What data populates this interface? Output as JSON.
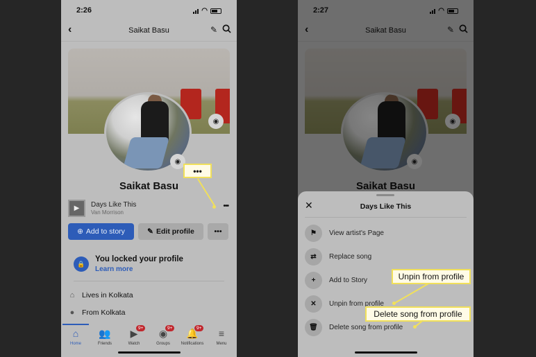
{
  "left_screen": {
    "status": {
      "time": "2:26"
    },
    "navbar": {
      "back": "‹",
      "title": "Saikat Basu",
      "edit_icon": "✎"
    },
    "profile_name": "Saikat Basu",
    "song": {
      "title": "Days Like This",
      "artist": "Van Morrison",
      "more": "•••"
    },
    "actions": {
      "add_story": "Add to story",
      "edit_profile": "Edit profile",
      "more": "•••"
    },
    "locked": {
      "heading": "You locked your profile",
      "link": "Learn more"
    },
    "info": [
      {
        "icon": "home-icon",
        "glyph": "⌂",
        "text": "Lives in Kolkata"
      },
      {
        "icon": "location-pin-icon",
        "glyph": "●",
        "text": "From Kolkata"
      }
    ],
    "tabs": [
      {
        "label": "Home",
        "glyph": "⌂",
        "badge": "",
        "active": true
      },
      {
        "label": "Friends",
        "glyph": "👥",
        "badge": ""
      },
      {
        "label": "Watch",
        "glyph": "▶",
        "badge": "9+"
      },
      {
        "label": "Groups",
        "glyph": "◉",
        "badge": "9+"
      },
      {
        "label": "Notifications",
        "glyph": "🔔",
        "badge": "9+"
      },
      {
        "label": "Menu",
        "glyph": "≡",
        "badge": ""
      }
    ],
    "callout": {
      "text": "•••"
    }
  },
  "right_screen": {
    "status": {
      "time": "2:27"
    },
    "navbar": {
      "back": "‹",
      "title": "Saikat Basu",
      "edit_icon": "✎"
    },
    "profile_name": "Saikat Basu",
    "sheet": {
      "title": "Days Like This",
      "close": "✕",
      "items": [
        {
          "icon": "flag-icon",
          "glyph": "⚑",
          "label": "View artist's Page"
        },
        {
          "icon": "swap-icon",
          "glyph": "⇄",
          "label": "Replace song"
        },
        {
          "icon": "plus-circle-icon",
          "glyph": "+",
          "label": "Add to Story"
        },
        {
          "icon": "x-circle-icon",
          "glyph": "✕",
          "label": "Unpin from profile"
        },
        {
          "icon": "trash-icon",
          "glyph": "🗑",
          "label": "Delete song from profile"
        }
      ]
    },
    "callouts": [
      {
        "text": "Unpin from profile"
      },
      {
        "text": "Delete song from profile"
      }
    ]
  },
  "colors": {
    "accent": "#2d5cb8",
    "badge": "#c0272d",
    "callout_border": "#f1e05a",
    "background": "#262626"
  }
}
